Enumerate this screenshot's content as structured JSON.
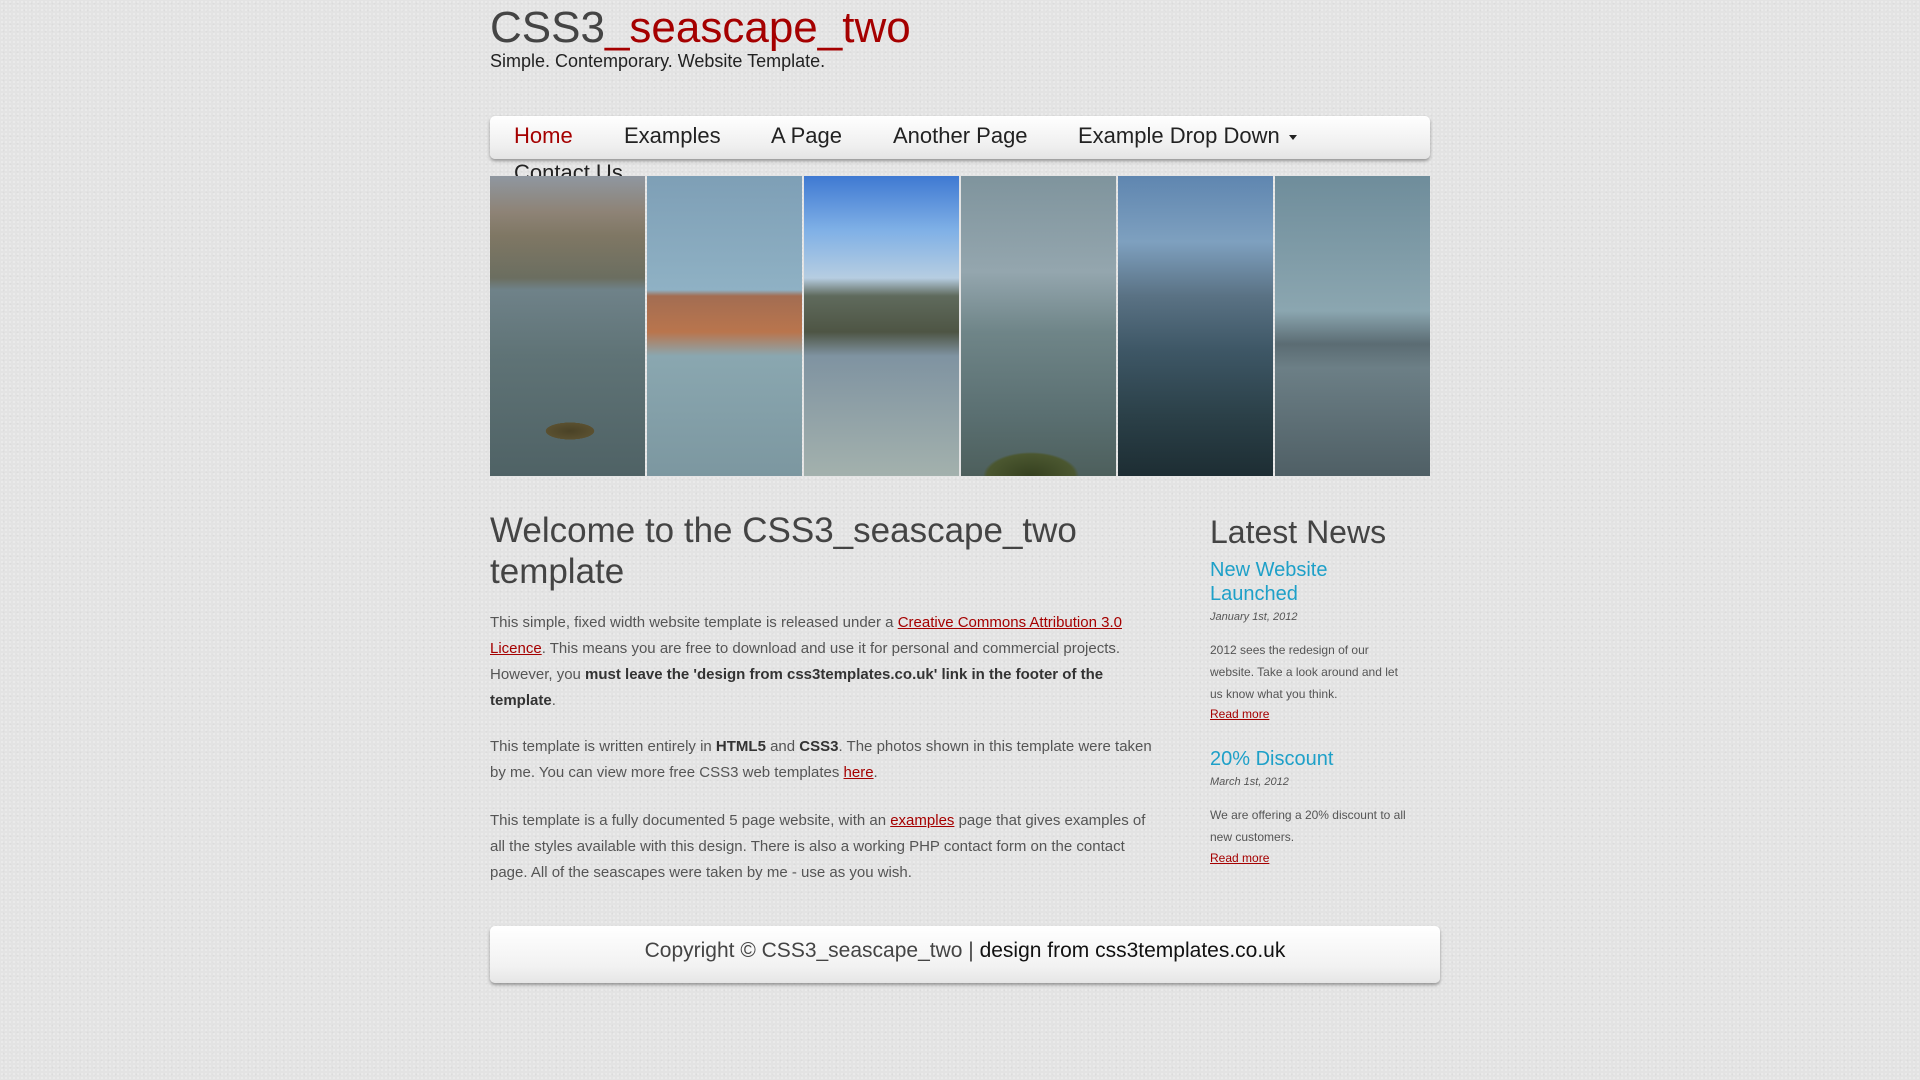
{
  "header": {
    "title_part1": "CSS3",
    "title_part2": "_seascape_two",
    "slogan": "Simple. Contemporary. Website Template."
  },
  "menu": {
    "items": [
      {
        "label": "Home",
        "active": true
      },
      {
        "label": "Examples"
      },
      {
        "label": "A Page"
      },
      {
        "label": "Another Page"
      },
      {
        "label": "Example Drop Down",
        "has_dropdown": true
      },
      {
        "label": "Contact Us"
      }
    ]
  },
  "banner": {
    "panels": [
      "seascape-1",
      "seascape-2",
      "seascape-3",
      "seascape-4",
      "seascape-5",
      "seascape-6"
    ]
  },
  "main": {
    "title": "Welcome to the CSS3_seascape_two template",
    "p1": {
      "t1": "This simple, fixed width website template is released under a ",
      "link": "Creative Commons Attribution 3.0 Licence",
      "t2": ". This means you are free to download and use it for personal and commercial projects. However, you ",
      "bold": "must leave the 'design from css3templates.co.uk' link in the footer of the template",
      "t3": "."
    },
    "p2": {
      "t1": "This template is written entirely in ",
      "bold1": "HTML5",
      "t2": " and ",
      "bold2": "CSS3",
      "t3": ". The photos shown in this template were taken by me. You can view more free CSS3 web templates ",
      "link": "here",
      "t4": "."
    },
    "p3": {
      "t1": "This template is a fully documented 5 page website, with an ",
      "link": "examples",
      "t2": " page that gives examples of all the styles available with this design. There is also a working PHP contact form on the contact page. All of the seascapes were taken by me - use as you wish."
    }
  },
  "sidebar": {
    "heading": "Latest News",
    "news": [
      {
        "title": "New Website Launched",
        "date": "January 1st, 2012",
        "body": "2012 sees the redesign of our website. Take a look around and let us know what you think.",
        "more": "Read more"
      },
      {
        "title": "20% Discount",
        "date": "March 1st, 2012",
        "body": "We are offering a 20% discount to all new customers.",
        "more": "Read more"
      }
    ]
  },
  "footer": {
    "copyright": "Copyright © CSS3_seascape_two | ",
    "link": "design from css3templates.co.uk"
  },
  "colors": {
    "accent_red": "#a50000",
    "news_blue": "#1ea0c8",
    "background": "#e3e3e3"
  }
}
